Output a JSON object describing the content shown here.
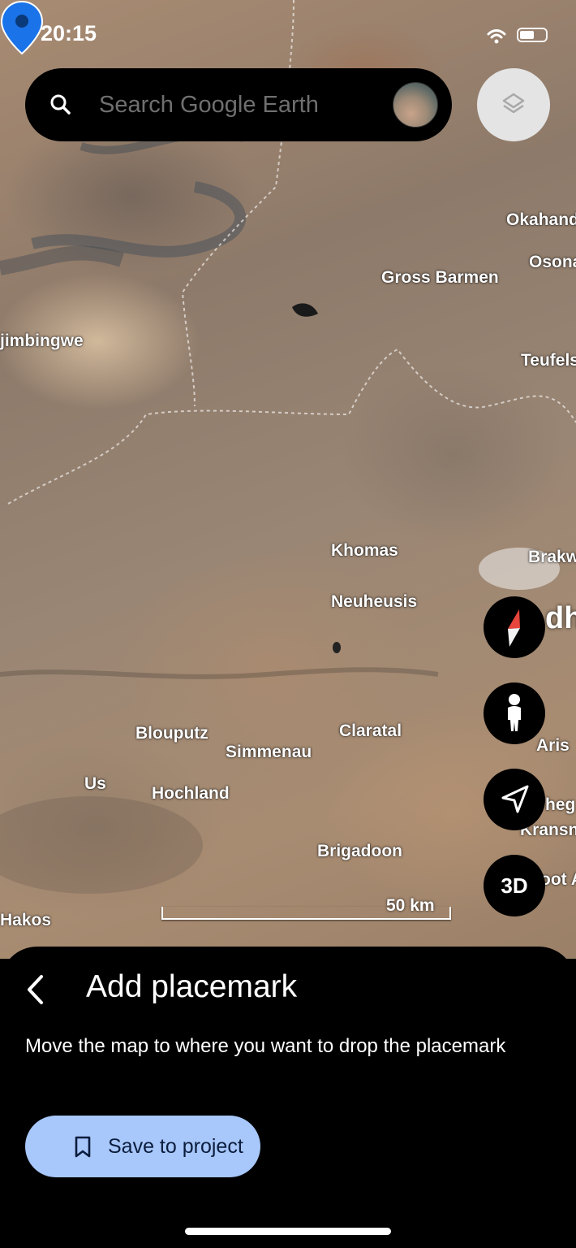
{
  "status_bar": {
    "time": "20:15",
    "battery_level": 0.55
  },
  "search": {
    "placeholder": "Search Google Earth"
  },
  "icons": {
    "search": "search-icon",
    "layers": "layers-icon",
    "compass": "compass-icon",
    "street_view": "pegman-icon",
    "my_location": "location-arrow-icon",
    "back": "chevron-left-icon",
    "bookmark": "bookmark-icon"
  },
  "map": {
    "labels": [
      {
        "id": "okahandja",
        "text": "Okahand"
      },
      {
        "id": "osona",
        "text": "Osona"
      },
      {
        "id": "gross-barmen",
        "text": "Gross Barmen"
      },
      {
        "id": "otjimbingwe",
        "text": "jimbingwe"
      },
      {
        "id": "teufelsbach",
        "text": "Teufels"
      },
      {
        "id": "khomas",
        "text": "Khomas"
      },
      {
        "id": "brakwater",
        "text": "Brakw"
      },
      {
        "id": "neuheusis",
        "text": "Neuheusis"
      },
      {
        "id": "blouputz",
        "text": "Blouputz"
      },
      {
        "id": "claratal",
        "text": "Claratal"
      },
      {
        "id": "simmenau",
        "text": "Simmenau"
      },
      {
        "id": "aris",
        "text": "Aris"
      },
      {
        "id": "us",
        "text": "Us"
      },
      {
        "id": "hochland",
        "text": "Hochland"
      },
      {
        "id": "kapps-farm",
        "text": "heg"
      },
      {
        "id": "kransneus",
        "text": "Kransne"
      },
      {
        "id": "brigadoon",
        "text": "Brigadoon"
      },
      {
        "id": "heroot",
        "text": "oot A"
      },
      {
        "id": "hakos",
        "text": "Hakos"
      }
    ],
    "big_label": "dh",
    "scale_label": "50 km",
    "three_d_label": "3D"
  },
  "sheet": {
    "title": "Add placemark",
    "description": "Move the map to where you want to drop the placemark",
    "save_button_label": "Save to project"
  },
  "colors": {
    "accent_button": "#a8c7fa",
    "pin": "#1a73e8",
    "compass_north": "#e8453c"
  }
}
